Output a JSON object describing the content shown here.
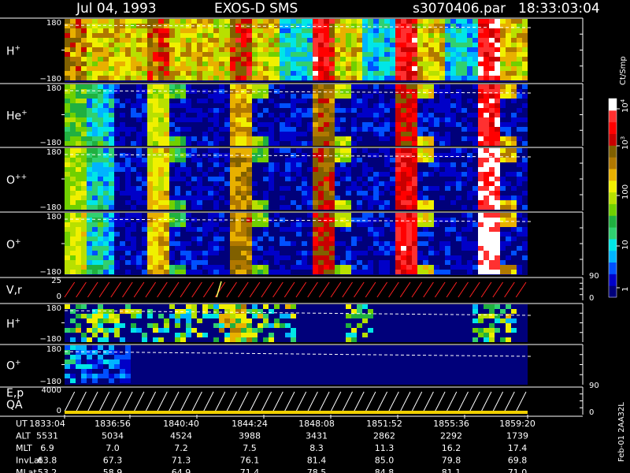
{
  "header": {
    "date": "Jul 04, 1993",
    "instrument": "EXOS-D SMS",
    "file": "s3070406.par",
    "time": "18:33:03:04"
  },
  "colorbar": {
    "unit": "Ct/Smp",
    "tick_labels": [
      "1",
      "10",
      "100",
      "10",
      "10"
    ],
    "tick_exponents": [
      "",
      "",
      "",
      "3",
      "4"
    ],
    "colors": [
      "#00007a",
      "#0000c8",
      "#0050ff",
      "#00b4ff",
      "#00e6e6",
      "#30d070",
      "#20b040",
      "#70d000",
      "#b8e000",
      "#f0f000",
      "#e8b000",
      "#b07800",
      "#806000",
      "#c80000",
      "#ff0000",
      "#ff3030",
      "#ffffff"
    ]
  },
  "panels": [
    {
      "name": "H",
      "sup": "+",
      "ymax": "180",
      "ymin": "−180"
    },
    {
      "name": "He",
      "sup": "+",
      "ymax": "180",
      "ymin": "−180"
    },
    {
      "name": "O",
      "sup": "++",
      "ymax": "180",
      "ymin": "−180"
    },
    {
      "name": "O",
      "sup": "+",
      "ymax": "180",
      "ymin": "−180",
      "right_tick": "90"
    },
    {
      "name": "V,r",
      "sup": "",
      "ymax": "25",
      "ymin": "0",
      "right_tick": "0"
    },
    {
      "name": "H",
      "sup": "+",
      "ymax": "180",
      "ymin": "−180"
    },
    {
      "name": "O",
      "sup": "+",
      "ymax": "180",
      "ymin": "−180",
      "right_tick": "90"
    },
    {
      "name": "E,p",
      "sup": "",
      "ymax": "4000",
      "ymin": "0",
      "right_tick": "0",
      "extra_label": "QA"
    }
  ],
  "side_label": "Feb-01 2AA32L",
  "table": {
    "rows": [
      {
        "label": "UT",
        "values": [
          "1833:04",
          "1836:56",
          "1840:40",
          "1844:24",
          "1848:08",
          "1851:52",
          "1855:36",
          "1859:20"
        ]
      },
      {
        "label": "ALT",
        "values": [
          "5531",
          "5034",
          "4524",
          "3988",
          "3431",
          "2862",
          "2292",
          "1739"
        ]
      },
      {
        "label": "MLT",
        "values": [
          "6.9",
          "7.0",
          "7.2",
          "7.5",
          "8.3",
          "11.3",
          "16.2",
          "17.4"
        ]
      },
      {
        "label": "InvLat",
        "values": [
          "63.8",
          "67.3",
          "71.3",
          "76.1",
          "81.4",
          "85.0",
          "79.8",
          "69.8"
        ]
      },
      {
        "label": "MLat",
        "values": [
          "53.2",
          "58.9",
          "64.9",
          "71.4",
          "78.5",
          "84.8",
          "81.1",
          "71.0"
        ]
      }
    ]
  },
  "chart_data": {
    "type": "heatmap",
    "title": "Jul 04, 1993   EXOS-D SMS",
    "x": {
      "label": "UT",
      "tick_labels": [
        "1833:04",
        "1836:56",
        "1840:40",
        "1844:24",
        "1848:08",
        "1851:52",
        "1855:36",
        "1859:20"
      ]
    },
    "colorscale": {
      "unit": "Ct/Smp",
      "scale": "log",
      "range": [
        1,
        10000
      ]
    },
    "panels": [
      {
        "species": "H+",
        "ylim": [
          -180,
          180
        ],
        "quantity": "pitch angle",
        "dominant": "high counts throughout, red bands after 1848"
      },
      {
        "species": "He+",
        "ylim": [
          -180,
          180
        ],
        "quantity": "pitch angle",
        "dominant": "spin-modulated stripes, intensifying after 1851"
      },
      {
        "species": "O++",
        "ylim": [
          -180,
          180
        ],
        "quantity": "pitch angle",
        "dominant": "spin-modulated stripes, red after 1855"
      },
      {
        "species": "O+",
        "ylim": [
          -180,
          180
        ],
        "quantity": "pitch angle",
        "dominant": "spin-modulated stripes, red after 1851"
      },
      {
        "species": "V,r",
        "ylim": [
          0,
          25
        ],
        "quantity": "sawtooth scan"
      },
      {
        "species": "H+",
        "ylim": [
          -180,
          180
        ],
        "quantity": "pitch angle",
        "dominant": "sporadic bursts 1833-1845 and 1855-1858"
      },
      {
        "species": "O+",
        "ylim": [
          -180,
          180
        ],
        "quantity": "pitch angle",
        "dominant": "low counts, brighter before 1836"
      },
      {
        "species": "E,p",
        "ylim": [
          0,
          4000
        ],
        "quantity": "energy scan"
      }
    ]
  }
}
